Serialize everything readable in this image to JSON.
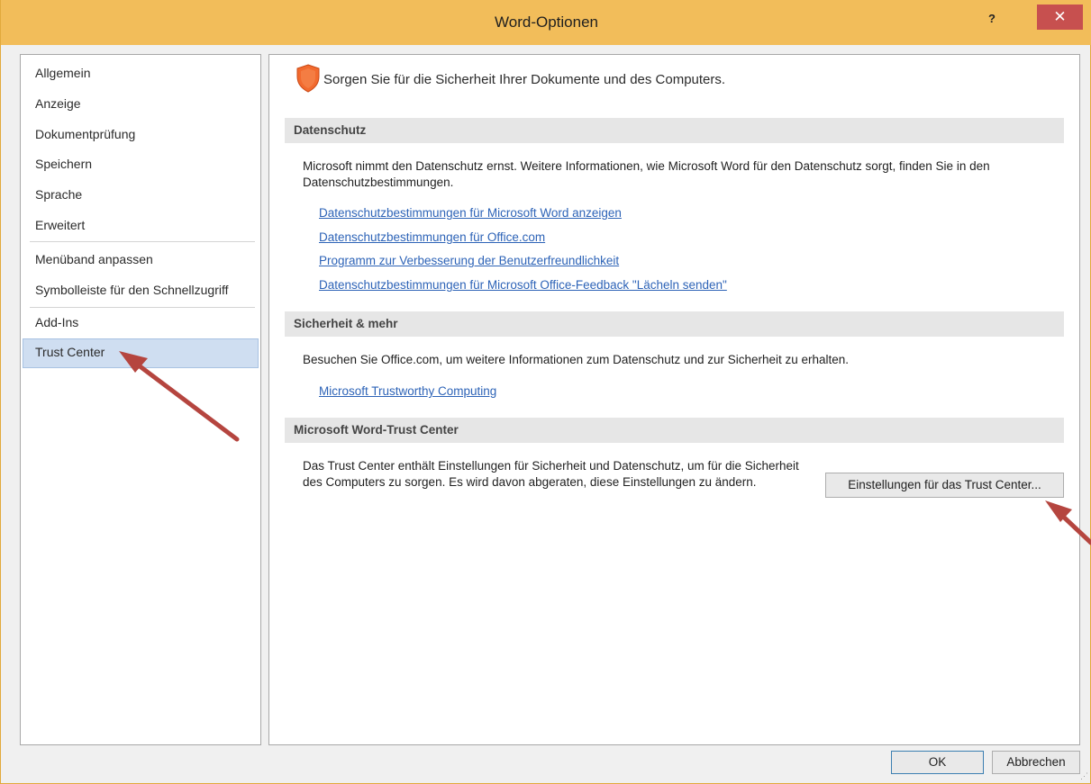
{
  "window": {
    "title": "Word-Optionen",
    "help_label": "?",
    "close_label": "✕"
  },
  "sidebar": {
    "items": [
      {
        "label": "Allgemein"
      },
      {
        "label": "Anzeige"
      },
      {
        "label": "Dokumentprüfung"
      },
      {
        "label": "Speichern"
      },
      {
        "label": "Sprache"
      },
      {
        "label": "Erweitert"
      },
      {
        "label": "Menüband anpassen"
      },
      {
        "label": "Symbolleiste für den Schnellzugriff"
      },
      {
        "label": "Add-Ins"
      },
      {
        "label": "Trust Center",
        "selected": true
      }
    ]
  },
  "main": {
    "header": "Sorgen Sie für die Sicherheit Ihrer Dokumente und des Computers.",
    "privacy": {
      "heading": "Datenschutz",
      "text": "Microsoft nimmt den Datenschutz ernst. Weitere Informationen, wie Microsoft Word für den Datenschutz sorgt, finden Sie in den Datenschutzbestimmungen.",
      "links": [
        "Datenschutzbestimmungen für Microsoft Word anzeigen",
        "Datenschutzbestimmungen für Office.com",
        "Programm zur Verbesserung der Benutzerfreundlichkeit",
        "Datenschutzbestimmungen für Microsoft Office-Feedback \"Lächeln senden\""
      ]
    },
    "security": {
      "heading": "Sicherheit & mehr",
      "text": "Besuchen Sie Office.com, um weitere Informationen zum Datenschutz und zur Sicherheit zu erhalten.",
      "link": "Microsoft Trustworthy Computing"
    },
    "trust_center": {
      "heading": "Microsoft Word-Trust Center",
      "text": "Das Trust Center enthält Einstellungen für Sicherheit und Datenschutz, um für die Sicherheit des Computers zu sorgen. Es wird davon abgeraten, diese Einstellungen zu ändern.",
      "button_label": "Einstellungen für das Trust Center..."
    }
  },
  "footer": {
    "ok_label": "OK",
    "cancel_label": "Abbrechen"
  },
  "colors": {
    "titlebar": "#f2bd5a",
    "close": "#c7504f",
    "link": "#2d63b7",
    "selected": "#cfdef1",
    "annotation_arrow": "#b5453f",
    "shield": "#f26a2e"
  }
}
